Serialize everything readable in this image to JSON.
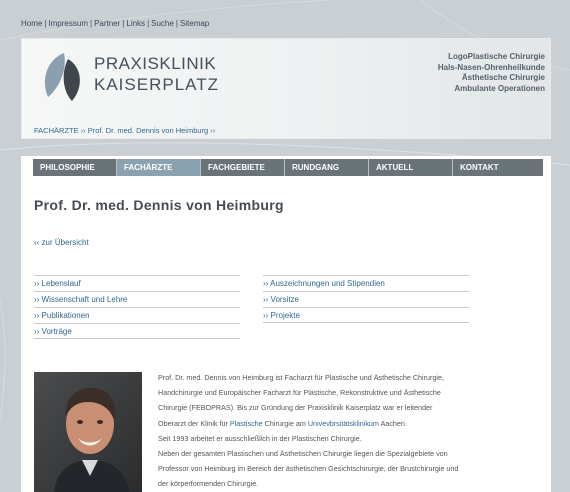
{
  "top_nav": [
    "Home",
    "Impressum",
    "Partner",
    "Links",
    "Suche",
    "Sitemap"
  ],
  "header": {
    "logo_line1": "PRAXISKLINIK",
    "logo_line2": "KAISERPLATZ",
    "specialties": [
      "LogoPlastische Chirurgie",
      "Hals-Nasen-Ohrenheilkunde",
      "Ästhetische Chirurgie",
      "Ambulante Operationen"
    ],
    "breadcrumb": "FACHÄRZTE ›› Prof. Dr. med. Dennis von Heimburg ››"
  },
  "main_nav": [
    {
      "label": "PHILOSOPHIE",
      "active": false
    },
    {
      "label": "FACHÄRZTE",
      "active": true
    },
    {
      "label": "FACHGEBIETE",
      "active": false
    },
    {
      "label": "RUNDGANG",
      "active": false
    },
    {
      "label": "AKTUELL",
      "active": false
    },
    {
      "label": "KONTAKT",
      "active": false
    }
  ],
  "page": {
    "title": "Prof. Dr. med. Dennis von Heimburg",
    "back_link": "‹‹ zur Übersicht"
  },
  "links_col1": [
    "›› Lebenslauf",
    "›› Wissenschaft und Lehre",
    "›› Publikationen",
    "›› Vorträge"
  ],
  "links_col2": [
    "›› Auszeichnungen und Stipendien",
    "›› Vorsitze",
    "›› Projekte"
  ],
  "bio": {
    "l1": "Prof. Dr. med. Dennis von Heimburg ist Facharzt für Plastische und Ästhetische Chirurgie,",
    "l2": "Handchirurgie und Europäischer Facharzt für Plastische, Rekonstruktive und Ästhetische",
    "l3": "Chirurgie (FEBOPRAS). Bis zur Gründung der Praxisklinik Kaiserplatz war er leitender",
    "l4a": "Oberarzt der Klinik für ",
    "l4b": "Plastische",
    "l4c": " Chirurgie am ",
    "l4d": "Univevbrsitätsklinikum",
    "l4e": " Aachen.",
    "l5": "Seit 1993 arbeitet er ausschließlich in der Plastischen Chirurgie.",
    "l6": "Neben der gesamten Plastischen und Ästhetischen Chirurgie liegen die Spezialgebiete von",
    "l7": "Professor von Heimburg im Bereich der ästhetischen Gesichtschirurgie, der Brustchirurgie und",
    "l8": "der körperformenden Chirurgie."
  },
  "colors": {
    "link": "#2d6b8f",
    "nav_bg": "#6a7378",
    "nav_active": "#8aa2b0",
    "page_bg": "#c9cfd3"
  }
}
